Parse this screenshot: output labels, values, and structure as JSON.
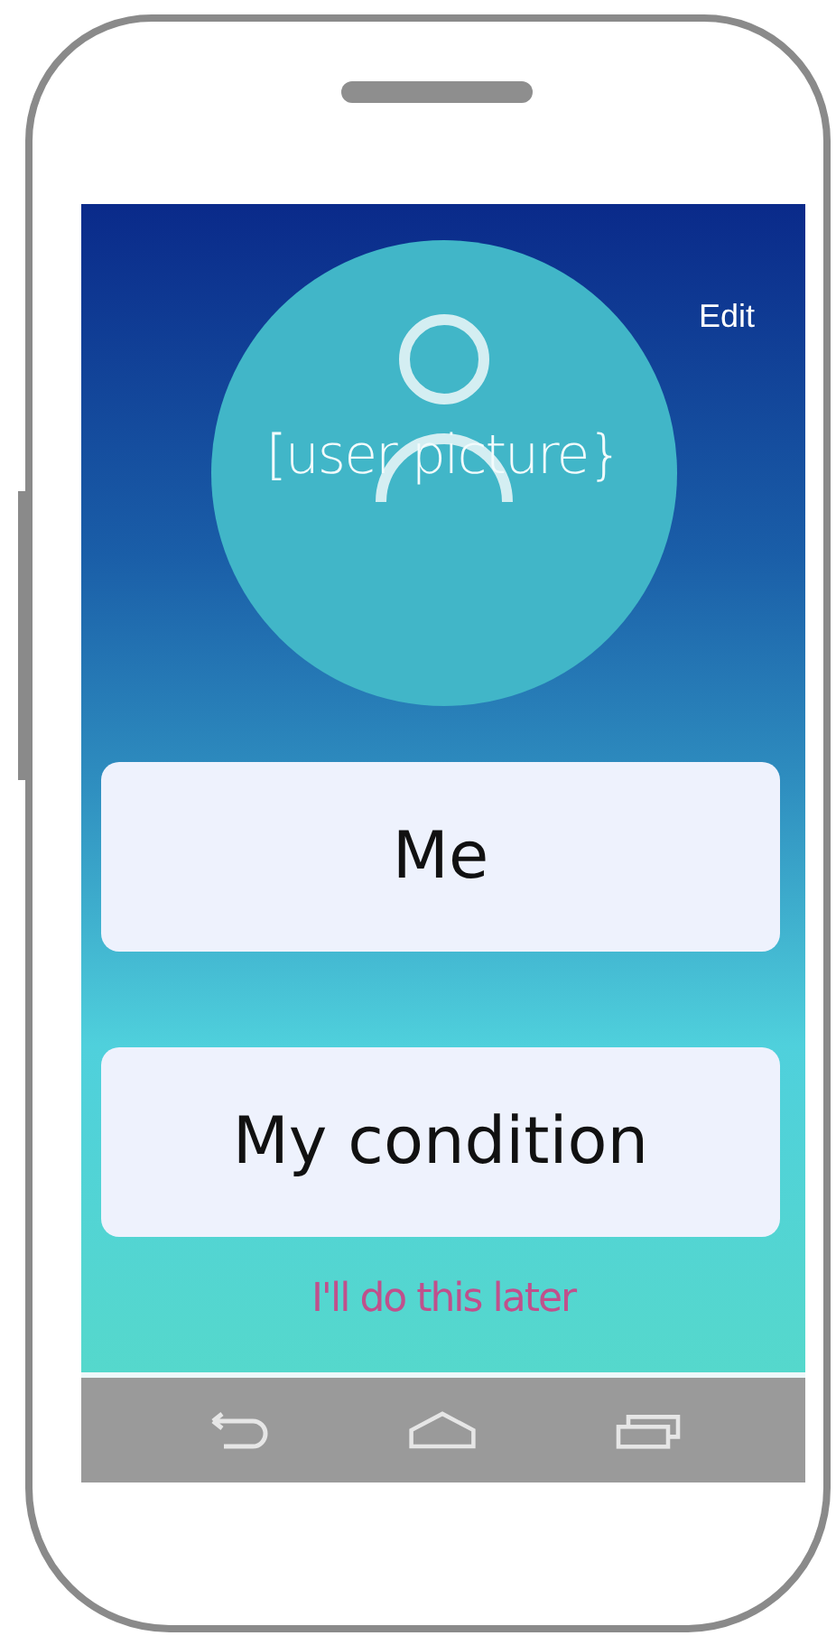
{
  "edit_link": "Edit",
  "avatar": {
    "label": "[user picture}"
  },
  "menu_buttons": [
    "Me",
    "My condition"
  ],
  "skip_link": "I'll do this later"
}
